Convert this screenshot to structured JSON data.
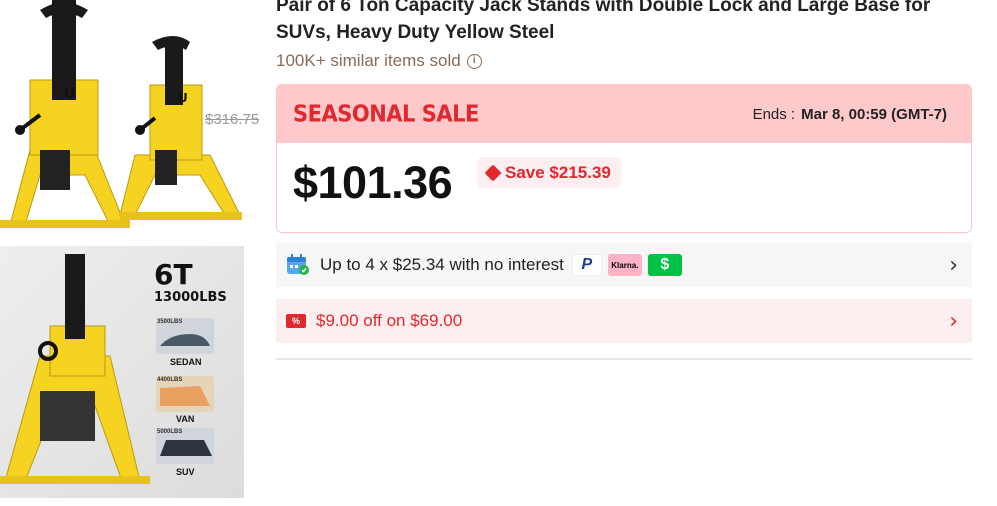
{
  "product": {
    "title": "Pair of 6 Ton Capacity Jack Stands with Double Lock and Large Base for SUVs, Heavy Duty Yellow Steel",
    "sold_text": "100K+ similar items sold",
    "thumbnail_badge": {
      "capacity": "6T",
      "weight": "13000LBS",
      "tiers": [
        {
          "load": "3500LBS",
          "vehicle": "SEDAN"
        },
        {
          "load": "4400LBS",
          "vehicle": "VAN"
        },
        {
          "load": "5000LBS",
          "vehicle": "SUV"
        }
      ]
    }
  },
  "sale": {
    "tag": "SEASONAL SALE",
    "ends_label": "Ends :",
    "ends_value": "Mar 8, 00:59 (GMT-7)",
    "price": "$101.36",
    "save": "Save $215.39",
    "original_price": "$316.75"
  },
  "installments": {
    "text": "Up to 4 x $25.34 with no interest",
    "providers": [
      "PayPal",
      "Klarna.",
      "Cash App"
    ],
    "klarna_label": "Klarna.",
    "cash_label": "$",
    "paypal_label": "P"
  },
  "coupon": {
    "icon_text": "%",
    "text": "$9.00 off on $69.00"
  },
  "colors": {
    "sale_red": "#e0282f",
    "sale_bg": "#fec9cb",
    "jack_yellow": "#f5d320"
  },
  "icons": {
    "info": "info-icon",
    "calendar": "calendar-icon",
    "coupon": "coupon-icon",
    "chevron": "chevron-right-icon",
    "tag": "price-tag-icon"
  }
}
